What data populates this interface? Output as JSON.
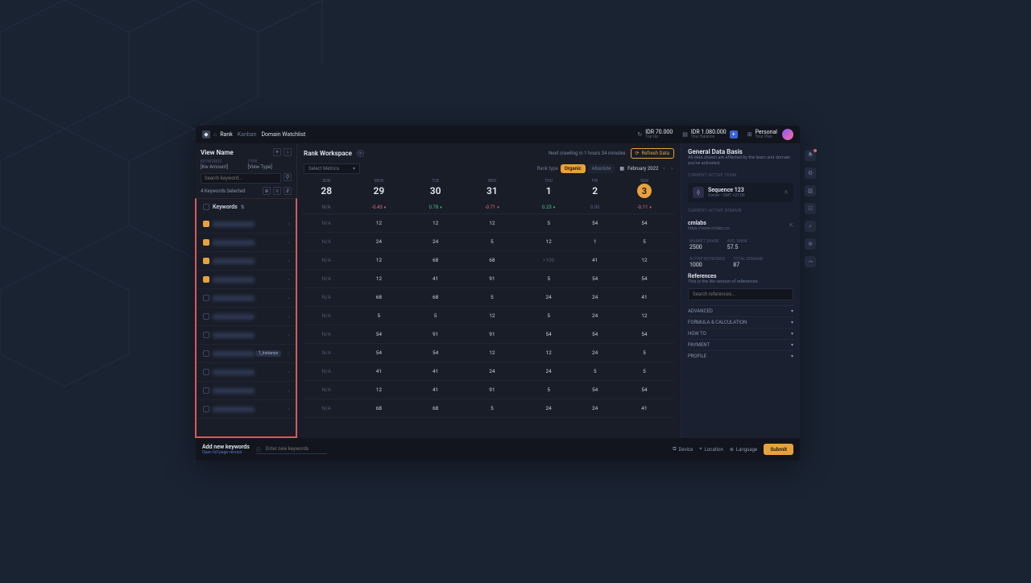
{
  "topbar": {
    "brand": "Rank",
    "crumbs": [
      "Kanban",
      "Domain Watchlist"
    ],
    "balance1": {
      "amount": "IDR 70.000",
      "sub": "Top Up"
    },
    "balance2": {
      "amount": "IDR 1.080.000",
      "sub": "Your Balance"
    },
    "workspace": {
      "name": "Personal",
      "sub": "Your Plan"
    }
  },
  "left": {
    "view_name": "View Name",
    "keywords_lbl": "KEYWORDS",
    "keywords_val": "[Kw Amount]",
    "type_lbl": "TYPE",
    "type_val": "[View Type]",
    "search_ph": "Search keyword...",
    "selected": "4 Keywords Selected",
    "column_header": "Keywords",
    "badge_instance": "1_Instance",
    "checked": [
      true,
      true,
      true,
      true,
      false,
      false,
      false,
      false,
      false,
      false,
      false
    ]
  },
  "center": {
    "workspace_title": "Rank Workspace",
    "crawl_info": "Next crawling in 1 hours 34 minutes",
    "refresh": "Refresh Data",
    "metrics_ph": "Select Metrics",
    "ranktype_lbl": "Rank type",
    "ranktype_opts": [
      "Organic",
      "Absolute"
    ],
    "month": "February 2022",
    "days": [
      {
        "dow": "SUN",
        "num": "28"
      },
      {
        "dow": "MON",
        "num": "29"
      },
      {
        "dow": "TUE",
        "num": "30"
      },
      {
        "dow": "WED",
        "num": "31"
      },
      {
        "dow": "THU",
        "num": "1"
      },
      {
        "dow": "FRI",
        "num": "2"
      },
      {
        "dow": "SUN",
        "num": "3",
        "sel": true
      }
    ],
    "deltas": [
      {
        "v": "N/A",
        "c": "na"
      },
      {
        "v": "-0.43",
        "c": "neg",
        "car": "▾"
      },
      {
        "v": "0.78",
        "c": "pos",
        "car": "▾"
      },
      {
        "v": "-0.71",
        "c": "neg",
        "car": "▾"
      },
      {
        "v": "0.23",
        "c": "pos",
        "car": "▾"
      },
      {
        "v": "0.00",
        "c": "na"
      },
      {
        "v": "-0.11",
        "c": "neg",
        "car": "▾"
      }
    ],
    "rows": [
      [
        "N/A",
        "12",
        "12",
        "12",
        "5",
        "54",
        "54"
      ],
      [
        "N/A",
        "24",
        "24",
        "5",
        "12",
        "1",
        "5"
      ],
      [
        "N/A",
        "12",
        "68",
        "68",
        ">100",
        "41",
        "12"
      ],
      [
        "N/A",
        "12",
        "41",
        "91",
        "5",
        "54",
        "54"
      ],
      [
        "N/A",
        "68",
        "68",
        "5",
        "24",
        "24",
        "41"
      ],
      [
        "N/A",
        "5",
        "5",
        "12",
        "5",
        "24",
        "12"
      ],
      [
        "N/A",
        "54",
        "91",
        "91",
        "54",
        "54",
        "54"
      ],
      [
        "N/A",
        "54",
        "54",
        "12",
        "12",
        "24",
        "5"
      ],
      [
        "N/A",
        "41",
        "41",
        "24",
        "24",
        "5",
        "5"
      ],
      [
        "N/A",
        "12",
        "41",
        "91",
        "5",
        "54",
        "54"
      ],
      [
        "N/A",
        "68",
        "68",
        "5",
        "24",
        "24",
        "41"
      ]
    ]
  },
  "bottom": {
    "add_label": "Add new keywords",
    "add_sub": "Open full page version",
    "input_ph": "Enter new keywords",
    "device": "Device",
    "location": "Location",
    "language": "Language",
    "submit": "Submit"
  },
  "right": {
    "title": "General Data Basis",
    "desc": "All data shown are affected by the team and domain you've activated.",
    "team_lbl": "CURRENT ACTIVE TEAM",
    "team_name": "Sequence 123",
    "team_sub": "Owner • GMT +07:00",
    "domain_lbl": "CURRENT ACTIVE DOMAIN",
    "domain_name": "cmlabs",
    "domain_url": "https://www.cmlabs.co",
    "stats": {
      "market_share_lbl": "MARKET SHARE",
      "market_share": "2500",
      "avg_rank_lbl": "AVG. RANK",
      "avg_rank": "57.5",
      "active_kw_lbl": "ACTIVE KEYWORDS",
      "active_kw": "1000",
      "total_demand_lbl": "TOTAL DEMAND",
      "total_demand": "87"
    },
    "ref_title": "References",
    "ref_desc": "This is the lite version of references.",
    "ref_ph": "Search references...",
    "accordion": [
      "ADVANCED",
      "FORMULA & CALCULATION",
      "HOW TO",
      "PAYMENT",
      "PROFILE"
    ]
  }
}
